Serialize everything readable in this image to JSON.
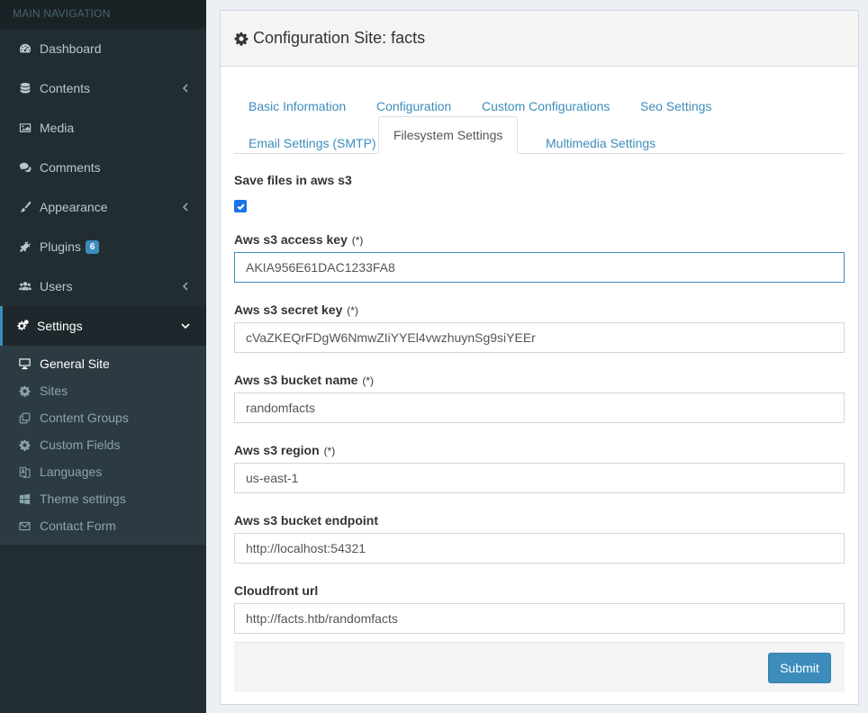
{
  "sidebar": {
    "header": "MAIN NAVIGATION",
    "items": [
      {
        "label": "Dashboard",
        "icon": "dashboard-icon"
      },
      {
        "label": "Contents",
        "icon": "database-icon"
      },
      {
        "label": "Media",
        "icon": "image-icon"
      },
      {
        "label": "Comments",
        "icon": "comments-icon"
      },
      {
        "label": "Appearance",
        "icon": "paint-brush-icon"
      },
      {
        "label": "Plugins",
        "icon": "plug-icon",
        "badge": "6"
      },
      {
        "label": "Users",
        "icon": "users-icon"
      },
      {
        "label": "Settings",
        "icon": "cogs-icon"
      }
    ],
    "submenu": [
      {
        "label": "General Site",
        "icon": "desktop-icon"
      },
      {
        "label": "Sites",
        "icon": "gear-icon"
      },
      {
        "label": "Content Groups",
        "icon": "clone-icon"
      },
      {
        "label": "Custom Fields",
        "icon": "gear-icon"
      },
      {
        "label": "Languages",
        "icon": "language-icon"
      },
      {
        "label": "Theme settings",
        "icon": "windows-icon"
      },
      {
        "label": "Contact Form",
        "icon": "envelope-icon"
      }
    ]
  },
  "page": {
    "title": "Configuration Site: facts"
  },
  "tabs": [
    "Basic Information",
    "Configuration",
    "Custom Configurations",
    "Seo Settings",
    "Email Settings (SMTP)",
    "Filesystem Settings",
    "Multimedia Settings"
  ],
  "form": {
    "save_s3_label": "Save files in aws s3",
    "save_s3_checked": true,
    "required_marker": "(*)",
    "access_key_label": "Aws s3 access key",
    "access_key_value": "AKIA956E61DAC1233FA8",
    "secret_key_label": "Aws s3 secret key",
    "secret_key_value": "cVaZKEQrFDgW6NmwZIiYYEl4vwzhuynSg9siYEEr",
    "bucket_name_label": "Aws s3 bucket name",
    "bucket_name_value": "randomfacts",
    "region_label": "Aws s3 region",
    "region_value": "us-east-1",
    "endpoint_label": "Aws s3 bucket endpoint",
    "endpoint_value": "http://localhost:54321",
    "cloudfront_label": "Cloudfront url",
    "cloudfront_value": "http://facts.htb/randomfacts",
    "submit_label": "Submit"
  },
  "colors": {
    "sidebar_bg": "#222d32",
    "accent": "#3c8dbc",
    "checkbox": "#1a73e8"
  }
}
